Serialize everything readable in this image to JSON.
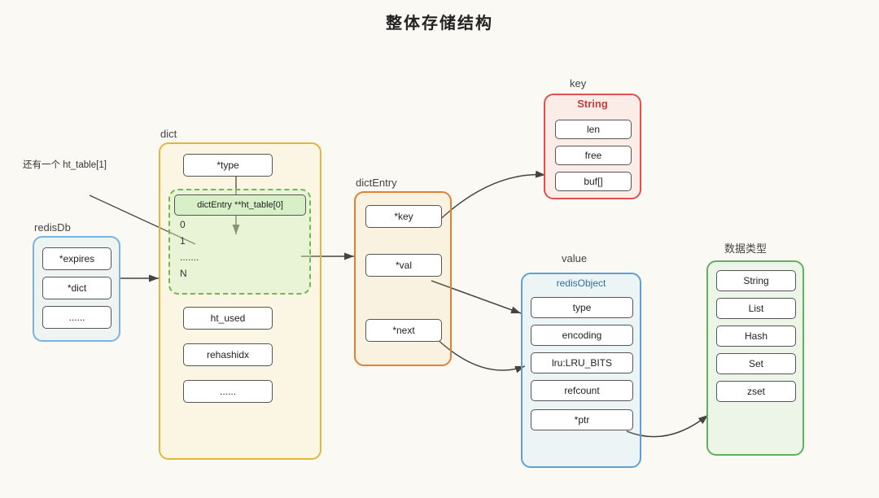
{
  "title": "整体存储结构",
  "labels": {
    "redisDb": "redisDb",
    "dict": "dict",
    "dictEntry": "dictEntry",
    "key": "key",
    "value": "value",
    "datatype": "数据类型",
    "redisObject": "redisObject",
    "note": "还有一个\nht_table[1]"
  },
  "redisdb_fields": [
    "*expires",
    "*dict",
    "......"
  ],
  "dict_fields": [
    "*type",
    "ht_used",
    "rehashidx",
    "......"
  ],
  "ht_table_fields": [
    "dictEntry **ht_table[0]",
    "0",
    "1",
    ".......",
    "N"
  ],
  "dictentry_fields": [
    "*key",
    "*val",
    "*next"
  ],
  "string_fields": [
    "len",
    "free",
    "buf[]"
  ],
  "redisobject_fields": [
    "type",
    "encoding",
    "lru:LRU_BITS",
    "refcount",
    "*ptr"
  ],
  "datatype_fields": [
    "String",
    "List",
    "Hash",
    "Set",
    "zset"
  ],
  "colors": {
    "blue": "#7ab3e0",
    "yellow": "#e0b840",
    "orange": "#e08030",
    "red": "#e05050",
    "bluelight": "#60a0d0",
    "green": "#60b060"
  }
}
